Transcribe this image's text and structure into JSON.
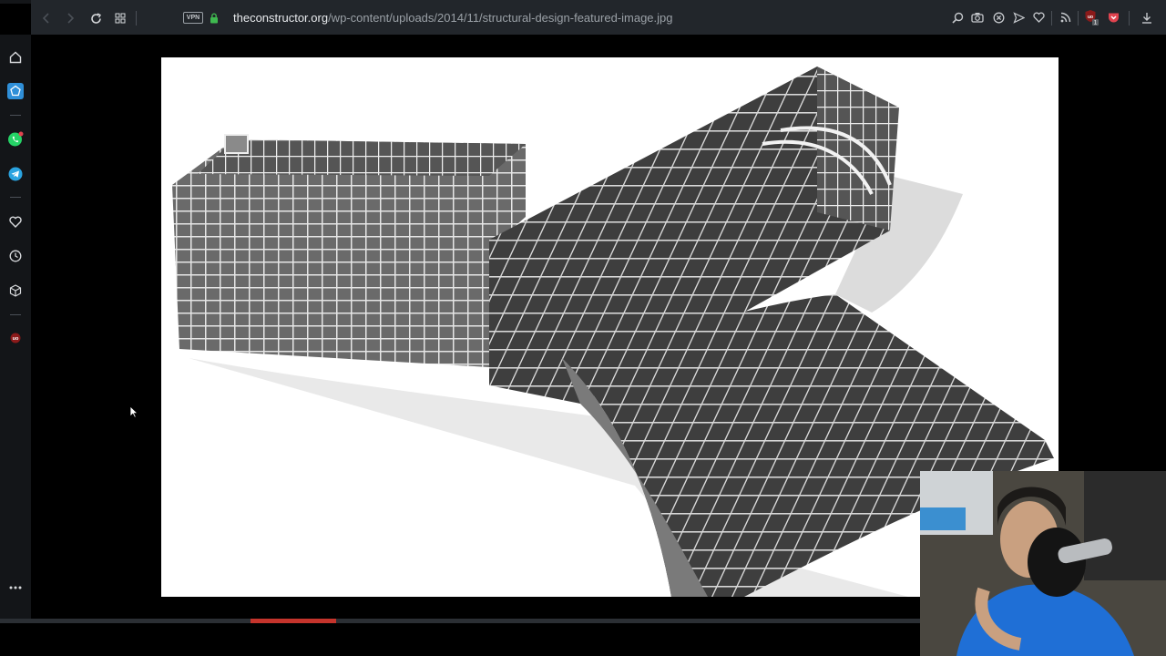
{
  "browser": {
    "url_host": "theconstructor.org",
    "url_path": "/wp-content/uploads/2014/11/structural-design-featured-image.jpg",
    "vpn_label": "VPN",
    "nav_icons": [
      "back-icon",
      "forward-icon",
      "reload-icon",
      "tabs-grid-icon"
    ],
    "toolbar_icons": [
      "search-zoom-icon",
      "camera-icon",
      "close-circle-icon",
      "send-icon",
      "heart-icon",
      "rss-icon",
      "ublock-icon",
      "pocket-icon",
      "download-icon"
    ],
    "badge_count": "1"
  },
  "sidebar": {
    "items": [
      "home-icon",
      "spaces-icon",
      "whatsapp-icon",
      "telegram-icon",
      "favorites-icon",
      "history-icon",
      "extensions-icon",
      "ublock-icon",
      "more-icon"
    ]
  },
  "viewer": {
    "image_name": "structural-design-featured-image"
  },
  "video": {
    "progress": 0.27
  },
  "colors": {
    "accent": "#c5342c",
    "topbar": "#22262b",
    "sidebar": "#131518"
  }
}
